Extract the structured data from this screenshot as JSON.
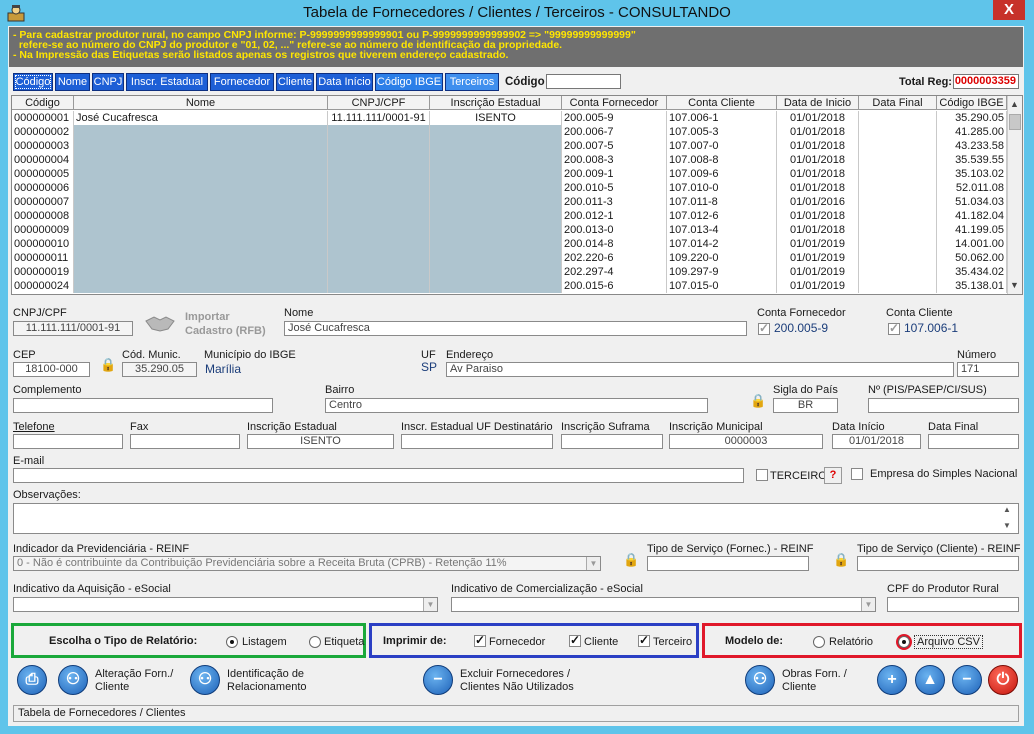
{
  "window": {
    "title": "Tabela de Fornecedores / Clientes / Terceiros   -   CONSULTANDO",
    "close": "X"
  },
  "notice": [
    "- Para  cadastrar  produtor  rural,  no  campo  CNPJ informe: P-9999999999999901 ou P-9999999999999902  =>  \"99999999999999\"",
    "  refere-se ao número do CNPJ do produtor e \"01, 02, ...\" refere-se ao número de identificação da propriedade.",
    "- Na Impressão das Etiquetas serão listados apenas os registros que tiverem endereço cadastrado."
  ],
  "tabs": [
    "Código",
    "Nome",
    "CNPJ",
    "Inscr. Estadual",
    "Fornecedor",
    "Cliente",
    "Data Início",
    "Código IBGE",
    "Terceiros"
  ],
  "search": {
    "label": "Código",
    "value": ""
  },
  "total": {
    "label": "Total Reg:",
    "value": "0000003359"
  },
  "grid": {
    "columns": [
      "Código",
      "Nome",
      "CNPJ/CPF",
      "Inscrição Estadual",
      "Conta Fornecedor",
      "Conta Cliente",
      "Data de Inicio",
      "Data Final",
      "Código IBGE"
    ],
    "rows": [
      [
        "000000001",
        "José Cucafresca",
        "11.111.111/0001-91",
        "ISENTO",
        "200.005-9",
        "107.006-1",
        "01/01/2018",
        "",
        "35.290.05"
      ],
      [
        "000000002",
        "",
        "",
        "",
        "200.006-7",
        "107.005-3",
        "01/01/2018",
        "",
        "41.285.00"
      ],
      [
        "000000003",
        "",
        "",
        "",
        "200.007-5",
        "107.007-0",
        "01/01/2018",
        "",
        "43.233.58"
      ],
      [
        "000000004",
        "",
        "",
        "",
        "200.008-3",
        "107.008-8",
        "01/01/2018",
        "",
        "35.539.55"
      ],
      [
        "000000005",
        "",
        "",
        "",
        "200.009-1",
        "107.009-6",
        "01/01/2018",
        "",
        "35.103.02"
      ],
      [
        "000000006",
        "",
        "",
        "",
        "200.010-5",
        "107.010-0",
        "01/01/2018",
        "",
        "52.011.08"
      ],
      [
        "000000007",
        "",
        "",
        "",
        "200.011-3",
        "107.011-8",
        "01/01/2016",
        "",
        "51.034.03"
      ],
      [
        "000000008",
        "",
        "",
        "",
        "200.012-1",
        "107.012-6",
        "01/01/2018",
        "",
        "41.182.04"
      ],
      [
        "000000009",
        "",
        "",
        "",
        "200.013-0",
        "107.013-4",
        "01/01/2018",
        "",
        "41.199.05"
      ],
      [
        "000000010",
        "",
        "",
        "",
        "200.014-8",
        "107.014-2",
        "01/01/2019",
        "",
        "14.001.00"
      ],
      [
        "000000011",
        "",
        "",
        "",
        "202.220-6",
        "109.220-0",
        "01/01/2019",
        "",
        "50.062.00"
      ],
      [
        "000000019",
        "",
        "",
        "",
        "202.297-4",
        "109.297-9",
        "01/01/2019",
        "",
        "35.434.02"
      ],
      [
        "000000024",
        "",
        "",
        "",
        "200.015-6",
        "107.015-0",
        "01/01/2019",
        "",
        "35.138.01"
      ]
    ]
  },
  "form": {
    "cnpj_label": "CNPJ/CPF",
    "cnpj_value": "11.111.111/0001-91",
    "import_label_1": "Importar",
    "import_label_2": "Cadastro (RFB)",
    "nome_label": "Nome",
    "nome_value": "José Cucafresca",
    "conta_forn_label": "Conta Fornecedor",
    "conta_forn_value": "200.005-9",
    "conta_cli_label": "Conta Cliente",
    "conta_cli_value": "107.006-1",
    "cep_label": "CEP",
    "cep_value": "18100-000",
    "cod_munic_label": "Cód. Munic.",
    "cod_munic_value": "35.290.05",
    "municipio_label": "Município do IBGE",
    "municipio_value": "Marília",
    "uf_label": "UF",
    "uf_value": "SP",
    "endereco_label": "Endereço",
    "endereco_value": "Av Paraiso",
    "numero_label": "Número",
    "numero_value": "171",
    "complemento_label": "Complemento",
    "complemento_value": "",
    "bairro_label": "Bairro",
    "bairro_value": "Centro",
    "sigla_pais_label": "Sigla do País",
    "sigla_pais_value": "BR",
    "pis_label": "Nº (PIS/PASEP/CI/SUS)",
    "pis_value": "",
    "telefone_label": "Telefone",
    "fax_label": "Fax",
    "ie_label": "Inscrição Estadual",
    "ie_value": "ISENTO",
    "ie_uf_dest_label": "Inscr. Estadual UF Destinatário",
    "suframa_label": "Inscrição Suframa",
    "im_label": "Inscrição Municipal",
    "im_value": "0000003",
    "data_inicio_label": "Data Início",
    "data_inicio_value": "01/01/2018",
    "data_final_label": "Data Final",
    "data_final_value": "",
    "email_label": "E-mail",
    "terceiro_label": "TERCEIRO",
    "help": "?",
    "simples_label": "Empresa do Simples Nacional",
    "obs_label": "Observações:",
    "reinf_label": "Indicador da Previdenciária - REINF",
    "reinf_value": "0 - Não é contribuinte da Contribuição Previdenciária sobre a Receita Bruta (CPRB) - Retenção 11%",
    "serv_forn_label": "Tipo de Serviço (Fornec.) - REINF",
    "serv_cli_label": "Tipo de Serviço (Cliente) - REINF",
    "aquisicao_label": "Indicativo da Aquisição - eSocial",
    "comerc_label": "Indicativo de Comercialização - eSocial",
    "cpf_prod_label": "CPF do Produtor Rural"
  },
  "report": {
    "tipo_label": "Escolha o Tipo de Relatório:",
    "listagem": "Listagem",
    "etiqueta": "Etiqueta",
    "imprimir_label": "Imprimir de:",
    "fornecedor": "Fornecedor",
    "cliente": "Cliente",
    "terceiro": "Terceiro",
    "modelo_label": "Modelo de:",
    "relatorio": "Relatório",
    "csv": "Arquivo CSV"
  },
  "buttons": {
    "alteracao_1": "Alteração Forn./",
    "alteracao_2": "Cliente",
    "ident_1": "Identificação de",
    "ident_2": "Relacionamento",
    "excluir_1": "Excluir Fornecedores /",
    "excluir_2": "Clientes Não Utilizados",
    "obras_1": "Obras Forn. /",
    "obras_2": "Cliente"
  },
  "status": "Tabela de Fornecedores / Clientes",
  "colors": {
    "titlebar": "#5fc4ea",
    "tab": "#1d5fd6",
    "notice_text": "#ffe600",
    "group_green": "#1aa83a",
    "group_blue": "#2b3fc4",
    "group_red": "#e0182a"
  }
}
